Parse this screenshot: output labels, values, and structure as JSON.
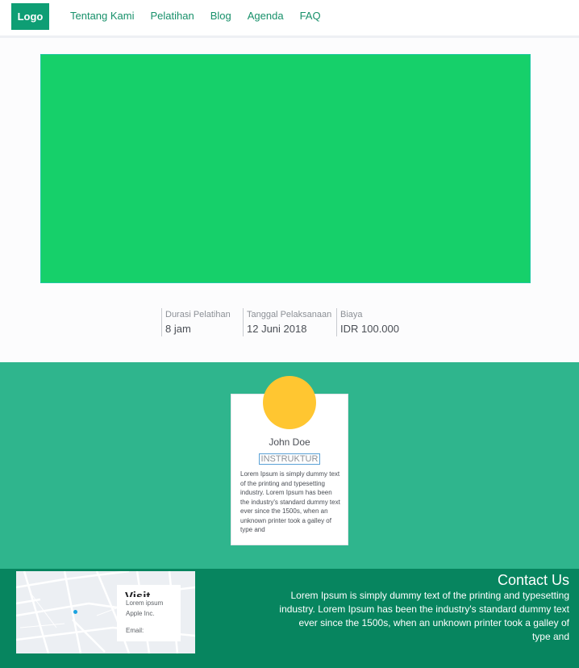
{
  "header": {
    "logo": "Logo",
    "nav": [
      "Tentang Kami",
      "Pelatihan",
      "Blog",
      "Agenda",
      "FAQ"
    ]
  },
  "hero": {
    "color": "#16d06a"
  },
  "stats": [
    {
      "label": "Durasi Pelatihan",
      "value": "8 jam"
    },
    {
      "label": "Tanggal Pelaksanaan",
      "value": "12 Juni 2018"
    },
    {
      "label": "Biaya",
      "value": "IDR 100.000"
    }
  ],
  "instructor": {
    "name": "John Doe",
    "role": "INSTRUKTUR",
    "description": "Lorem Ipsum is simply dummy text of the printing and typesetting industry. Lorem Ipsum has been the industry's standard dummy text ever since the 1500s, when an unknown printer took a galley of type and"
  },
  "map": {
    "title": "Visit",
    "lines": [
      "Lorem ipsum",
      "Apple Inc.",
      "Email:"
    ]
  },
  "contact": {
    "title": "Contact Us",
    "text": "Lorem Ipsum is simply dummy text of the printing and typesetting industry. Lorem Ipsum has been the industry's standard dummy text ever since the 1500s, when an unknown printer took a galley of type and"
  },
  "colors": {
    "accent": "#0e9e74",
    "teal": "#2fb58d",
    "footer": "#07855f",
    "avatar": "#ffc631"
  }
}
